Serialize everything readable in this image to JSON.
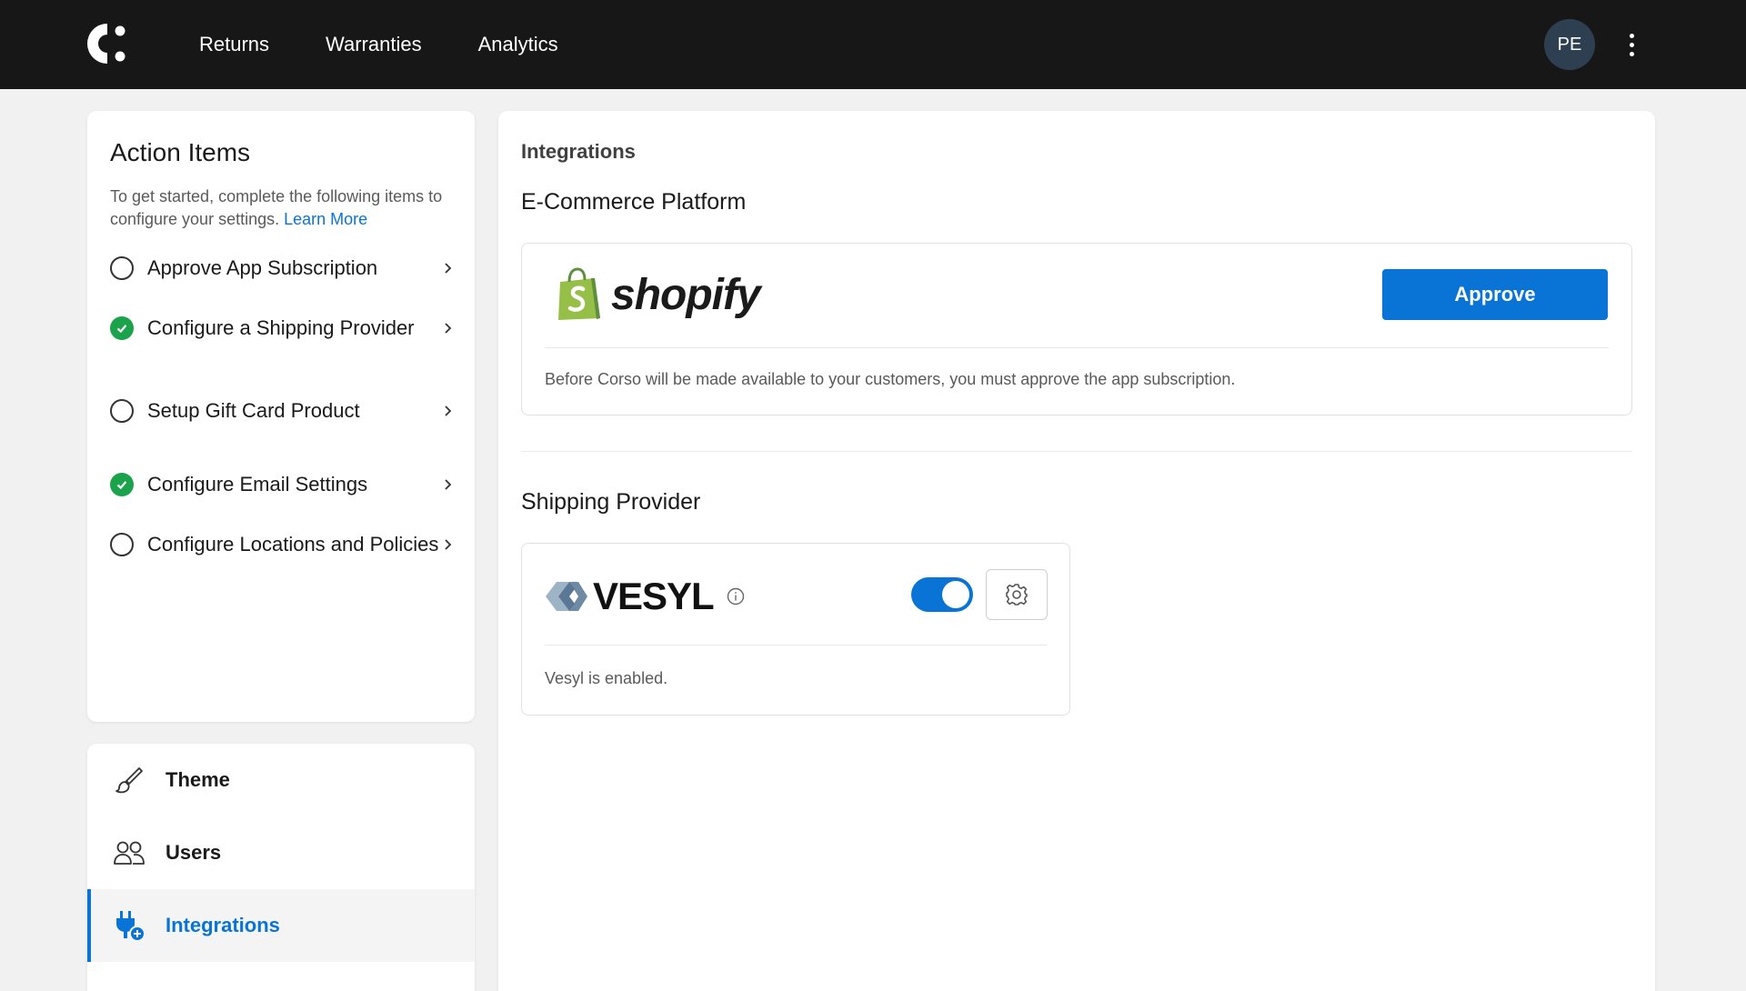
{
  "nav": {
    "items": [
      {
        "label": "Returns"
      },
      {
        "label": "Warranties"
      },
      {
        "label": "Analytics"
      }
    ],
    "avatar_initials": "PE"
  },
  "action_items": {
    "title": "Action Items",
    "description": "To get started, complete the following items to configure your settings.",
    "learn_more": "Learn More",
    "items": [
      {
        "label": "Approve App Subscription",
        "completed": false
      },
      {
        "label": "Configure a Shipping Provider",
        "completed": true
      },
      {
        "label": "Setup Gift Card Product",
        "completed": false
      },
      {
        "label": "Configure Email Settings",
        "completed": true
      },
      {
        "label": "Configure Locations and Policies",
        "completed": false
      }
    ]
  },
  "settings_nav": {
    "items": [
      {
        "label": "Theme",
        "icon": "paintbrush-icon"
      },
      {
        "label": "Users",
        "icon": "users-icon"
      },
      {
        "label": "Integrations",
        "icon": "plug-icon",
        "active": true
      }
    ]
  },
  "integrations": {
    "title": "Integrations",
    "ecommerce": {
      "section_title": "E-Commerce Platform",
      "brand": "shopify",
      "approve_label": "Approve",
      "note": "Before Corso will be made available to your customers, you must approve the app subscription."
    },
    "shipping": {
      "section_title": "Shipping Provider",
      "brand": "VESYL",
      "enabled": true,
      "note": "Vesyl is enabled."
    }
  },
  "colors": {
    "accent": "#0a74d6",
    "topbar": "#171717",
    "success": "#1aa34a",
    "shopify_green": "#95bf47"
  }
}
